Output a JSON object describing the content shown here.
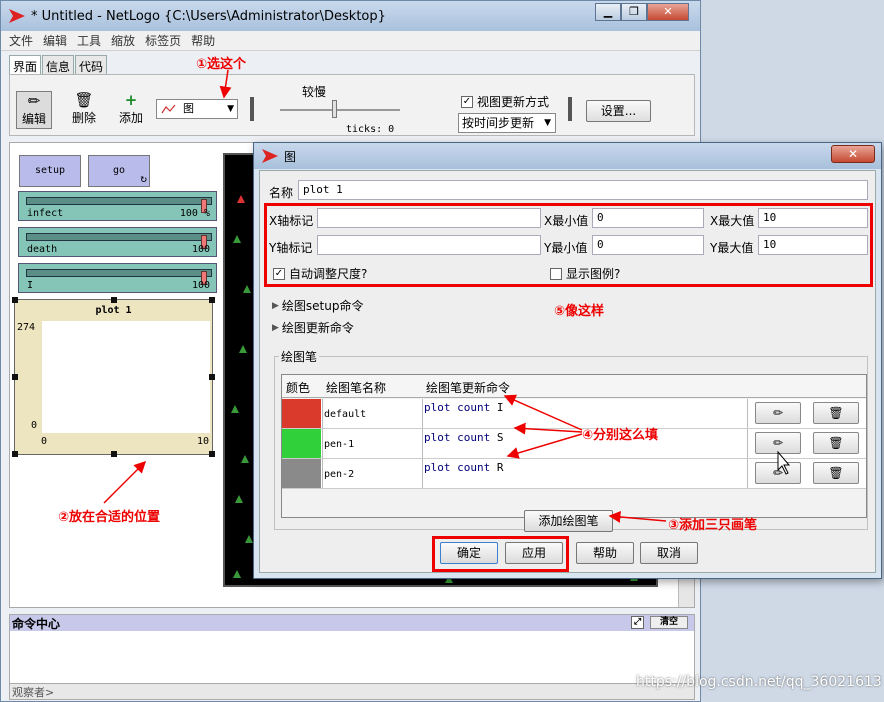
{
  "main_window": {
    "title": "* Untitled - NetLogo {C:\\Users\\Administrator\\Desktop}",
    "controls": {
      "minimize": "▁",
      "maximize": "❐",
      "close": "✕"
    },
    "menu": [
      "文件",
      "编辑",
      "工具",
      "缩放",
      "标签页",
      "帮助"
    ],
    "tabs": [
      "界面",
      "信息",
      "代码"
    ],
    "toolbar": {
      "edit_label": "编辑",
      "delete_label": "删除",
      "add_label": "添加",
      "widget_select_value": "图",
      "speed_label": "较慢",
      "ticks_label": "ticks: 0",
      "view_update_label": "视图更新方式",
      "update_mode_value": "按时间步更新",
      "settings_label": "设置..."
    }
  },
  "interface": {
    "setup_label": "setup",
    "go_label": "go",
    "sliders": [
      {
        "name": "infect",
        "value": "100 %"
      },
      {
        "name": "death",
        "value": "100"
      },
      {
        "name": "I",
        "value": "100"
      }
    ],
    "plot": {
      "title": "plot 1",
      "y_max": "274",
      "y_min": "0",
      "x_min": "0",
      "x_max": "10"
    }
  },
  "command_center": {
    "title": "命令中心",
    "clear_label": "清空",
    "observer_label": "观察者>"
  },
  "dialog": {
    "title": "图",
    "name_label": "名称",
    "name_value": "plot 1",
    "x_axis_label": "X轴标记",
    "x_min_label": "X最小值",
    "x_min_value": "0",
    "x_max_label": "X最大值",
    "x_max_value": "10",
    "y_axis_label": "Y轴标记",
    "y_min_label": "Y最小值",
    "y_min_value": "0",
    "y_max_label": "Y最大值",
    "y_max_value": "10",
    "autoscale_label": "自动调整尺度?",
    "autoscale_checked": true,
    "legend_label": "显示图例?",
    "legend_checked": false,
    "setup_commands_label": "绘图setup命令",
    "update_commands_label": "绘图更新命令",
    "pens_group_label": "绘图笔",
    "pens_columns": [
      "颜色",
      "绘图笔名称",
      "绘图笔更新命令"
    ],
    "pens": [
      {
        "color": "#d93a2b",
        "name": "default",
        "cmd_kw": "plot count",
        "cmd_var": "I"
      },
      {
        "color": "#2fd03a",
        "name": "pen-1",
        "cmd_kw": "plot count",
        "cmd_var": "S"
      },
      {
        "color": "#8a8a8a",
        "name": "pen-2",
        "cmd_kw": "plot count",
        "cmd_var": "R"
      }
    ],
    "add_pen_label": "添加绘图笔",
    "ok_label": "确定",
    "apply_label": "应用",
    "help_label": "帮助",
    "cancel_label": "取消"
  },
  "annotations": {
    "a1": "①选这个",
    "a2": "②放在合适的位置",
    "a3": "③添加三只画笔",
    "a4": "④分别这么填",
    "a5": "⑤像这样"
  },
  "watermark": "https://blog.csdn.net/qq_36021613",
  "colors": {
    "annotation_red": "#e00000",
    "button_purple": "#b9bbea",
    "slider_teal": "#84c5b7",
    "plot_bg": "#ede4c0"
  }
}
